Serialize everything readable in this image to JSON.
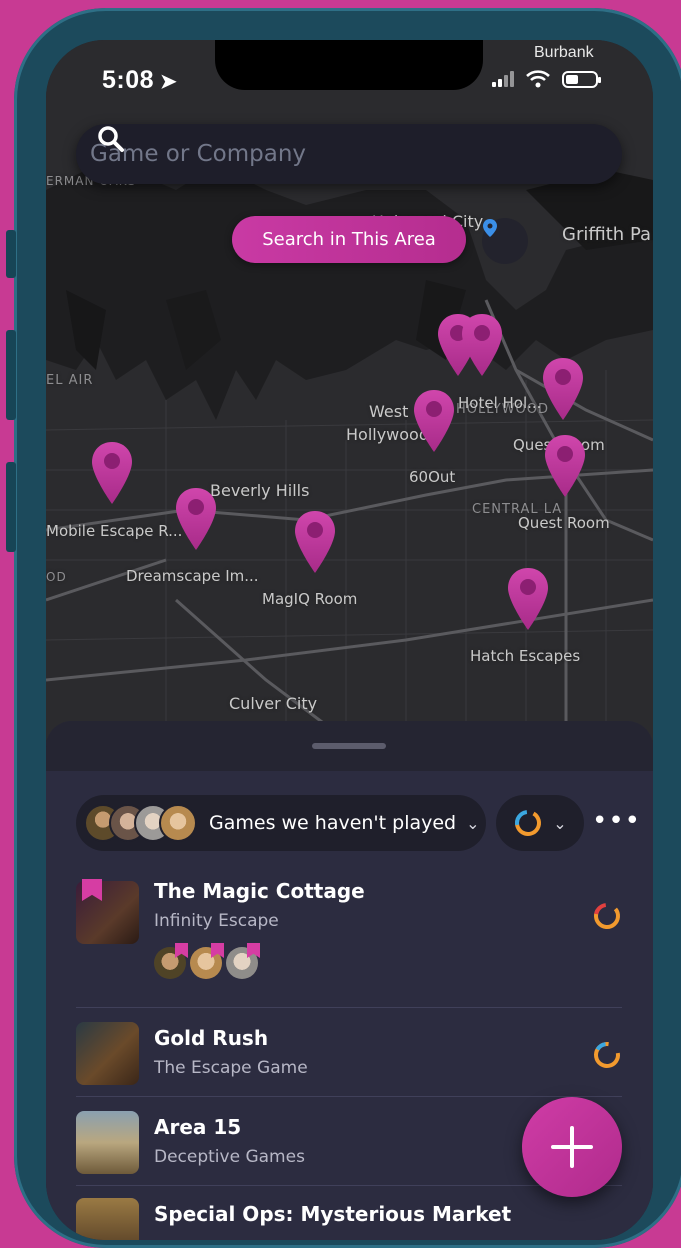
{
  "status_bar": {
    "time": "5:08",
    "carrier": "Burbank"
  },
  "search": {
    "placeholder": "Game or Company"
  },
  "map": {
    "search_area_label": "Search in This Area",
    "places": [
      {
        "text": "Universal City",
        "kind": "place"
      },
      {
        "text": "Griffith Pa",
        "kind": "place"
      },
      {
        "text": "ERMAN OAKS",
        "kind": "place"
      },
      {
        "text": "EL AIR",
        "kind": "area"
      },
      {
        "text": "West",
        "kind": "place"
      },
      {
        "text": "Hollywood",
        "kind": "place"
      },
      {
        "text": "HOLLYWOOD",
        "kind": "area"
      },
      {
        "text": "Beverly Hills",
        "kind": "place"
      },
      {
        "text": "CENTRAL LA",
        "kind": "area"
      },
      {
        "text": "OD",
        "kind": "area"
      },
      {
        "text": "Culver City",
        "kind": "place"
      }
    ],
    "venues": [
      {
        "text": "Hotel Hol..."
      },
      {
        "text": "Quest Room"
      },
      {
        "text": "60Out"
      },
      {
        "text": "Quest Room"
      },
      {
        "text": "Mobile Escape R..."
      },
      {
        "text": "Dreamscape Im..."
      },
      {
        "text": "MagIQ Room"
      },
      {
        "text": "Hatch Escapes"
      }
    ]
  },
  "filter": {
    "label": "Games we haven't played"
  },
  "games": [
    {
      "title": "The Magic Cottage",
      "company": "Infinity Escape"
    },
    {
      "title": "Gold Rush",
      "company": "The Escape Game"
    },
    {
      "title": "Area 15",
      "company": "Deceptive Games"
    },
    {
      "title": "Special Ops: Mysterious Market"
    }
  ],
  "colors": {
    "accent": "#c93aa4",
    "background": "#2c2c40",
    "ring_orange": "#f29a2e",
    "ring_blue": "#3ba7e0"
  }
}
